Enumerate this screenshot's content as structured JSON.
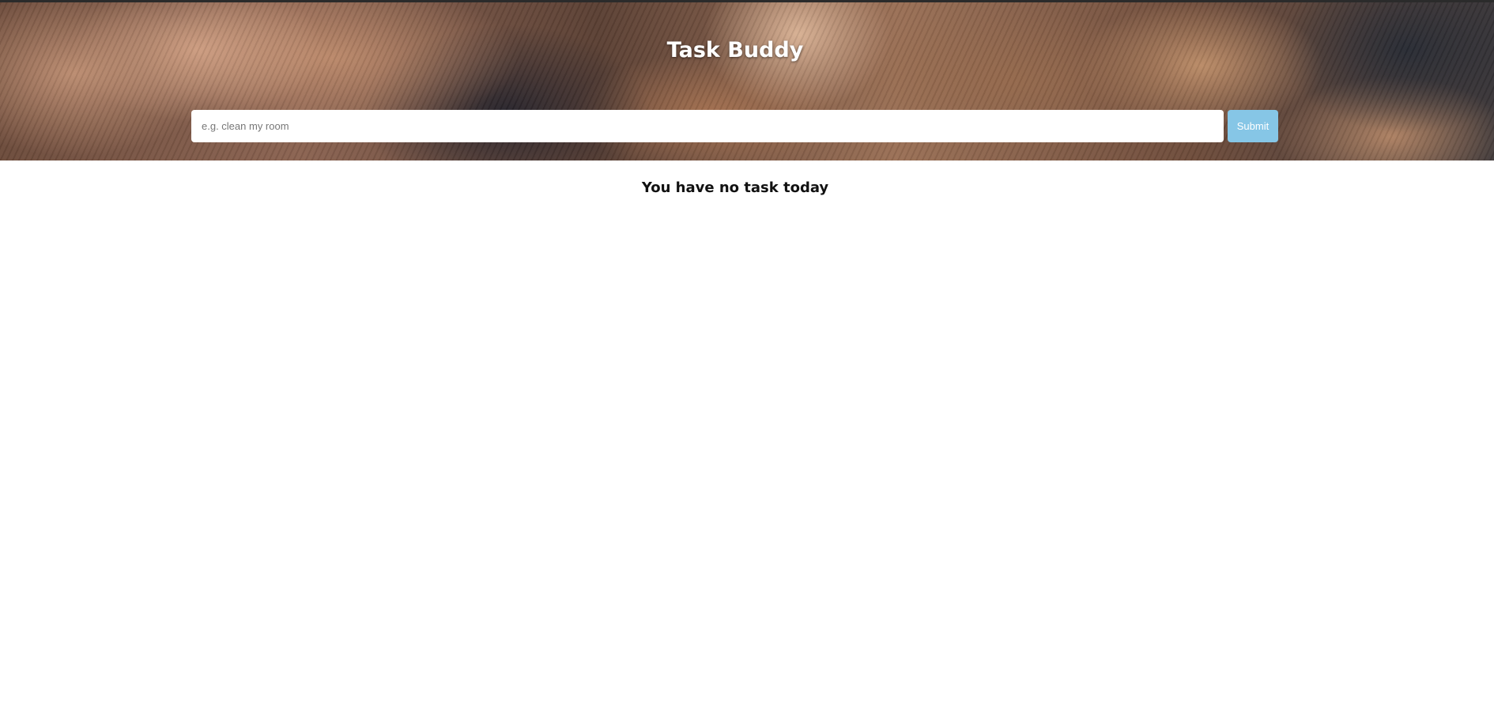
{
  "app": {
    "title": "Task Buddy"
  },
  "task_form": {
    "input_value": "",
    "input_placeholder": "e.g. clean my room",
    "submit_label": "Submit",
    "submit_color": "#86c6e6"
  },
  "task_list": {
    "empty_message": "You have no task today"
  }
}
